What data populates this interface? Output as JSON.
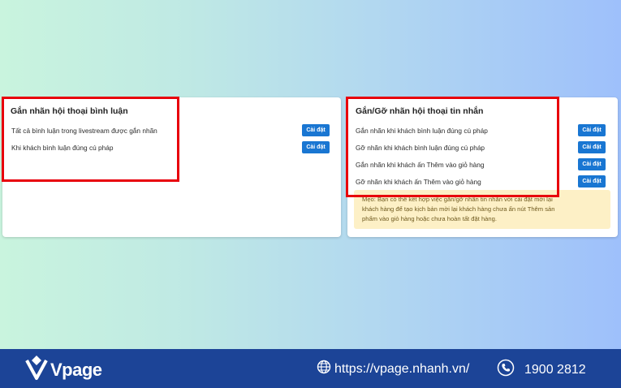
{
  "left_card": {
    "title": "Gắn nhãn hội thoại bình luận",
    "rows": [
      {
        "label": "Tất cả bình luận trong livestream được gắn nhãn",
        "button": "Cài đặt"
      },
      {
        "label": "Khi khách bình luận đúng cú pháp",
        "button": "Cài đặt"
      }
    ]
  },
  "right_card": {
    "title": "Gắn/Gỡ nhãn hội thoại tin nhắn",
    "rows": [
      {
        "label": "Gắn nhãn khi khách bình luận đúng cú pháp",
        "button": "Cài đặt"
      },
      {
        "label": "Gỡ nhãn khi khách bình luận đúng cú pháp",
        "button": "Cài đặt"
      },
      {
        "label": "Gắn nhãn khi khách ấn Thêm vào giỏ hàng",
        "button": "Cài đặt"
      },
      {
        "label": "Gỡ nhãn khi khách ấn Thêm vào giỏ hàng",
        "button": "Cài đặt"
      }
    ],
    "tip": {
      "lines": [
        "Mẹo: Bạn có thể kết hợp việc gắn/gỡ nhãn tin nhắn với cài đặt mời lại",
        "khách hàng để tạo kịch bản mời lại khách hàng chưa ấn nút Thêm sản",
        "phẩm vào giỏ hàng hoặc chưa hoàn tất đặt hàng."
      ]
    }
  },
  "footer": {
    "logo_text": "Vpage",
    "website": "https://vpage.nhanh.vn/",
    "phone": "1900 2812"
  },
  "colors": {
    "button": "#1976d2",
    "highlight": "#e8000b",
    "footer_bg": "#1c4497",
    "tip_bg": "#fdf0c6"
  },
  "icons": [
    "vpage-logo-icon",
    "globe-icon",
    "phone-icon"
  ]
}
